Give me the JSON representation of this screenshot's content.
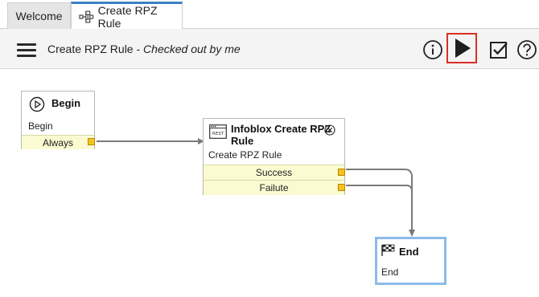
{
  "tabs": [
    {
      "label": "Welcome",
      "active": false,
      "icon": "none"
    },
    {
      "label": "Create RPZ Rule",
      "active": true,
      "icon": "workflow-icon"
    }
  ],
  "toolbar": {
    "title": "Create RPZ Rule",
    "separator": " - ",
    "subtitle": "Checked out by me",
    "buttons": [
      "menu-icon",
      "info-icon",
      "run-icon",
      "checkin-icon",
      "help-icon"
    ]
  },
  "workflow": {
    "begin": {
      "title": "Begin",
      "description": "Begin",
      "ports": [
        "Always"
      ]
    },
    "task": {
      "title_line1": "Infoblox Create RPZ",
      "title_line2": "Rule",
      "description": "Create RPZ Rule",
      "ports": [
        "Success",
        "Failute"
      ],
      "badge": "REST"
    },
    "end": {
      "title": "End",
      "description": "End"
    }
  },
  "colors": {
    "accent": "#3d7fc4",
    "highlight": "#d93025",
    "port_bg": "#fbfbd2",
    "port_handle": "#f6c21b"
  }
}
